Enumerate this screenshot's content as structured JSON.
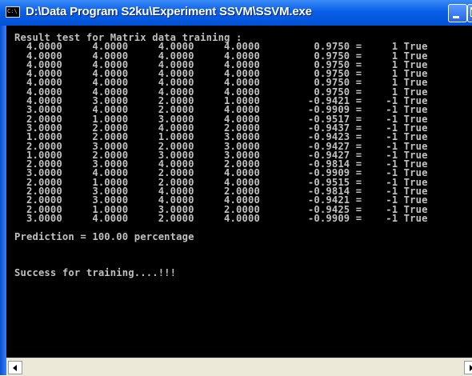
{
  "window": {
    "title": "D:\\Data Program S2ku\\Experiment SSVM\\SSVM.exe",
    "icon_text": "C:\\"
  },
  "console": {
    "header": "Result test for Matrix data training :",
    "rows": [
      [
        "4.0000",
        "4.0000",
        "4.0000",
        "4.0000",
        "0.9750",
        "1",
        "True"
      ],
      [
        "4.0000",
        "4.0000",
        "4.0000",
        "4.0000",
        "0.9750",
        "1",
        "True"
      ],
      [
        "4.0000",
        "4.0000",
        "4.0000",
        "4.0000",
        "0.9750",
        "1",
        "True"
      ],
      [
        "4.0000",
        "4.0000",
        "4.0000",
        "4.0000",
        "0.9750",
        "1",
        "True"
      ],
      [
        "4.0000",
        "4.0000",
        "4.0000",
        "4.0000",
        "0.9750",
        "1",
        "True"
      ],
      [
        "4.0000",
        "4.0000",
        "4.0000",
        "4.0000",
        "0.9750",
        "1",
        "True"
      ],
      [
        "4.0000",
        "3.0000",
        "2.0000",
        "1.0000",
        "-0.9421",
        "-1",
        "True"
      ],
      [
        "3.0000",
        "4.0000",
        "2.0000",
        "4.0000",
        "-0.9909",
        "-1",
        "True"
      ],
      [
        "2.0000",
        "1.0000",
        "3.0000",
        "4.0000",
        "-0.9517",
        "-1",
        "True"
      ],
      [
        "3.0000",
        "2.0000",
        "4.0000",
        "2.0000",
        "-0.9437",
        "-1",
        "True"
      ],
      [
        "1.0000",
        "2.0000",
        "1.0000",
        "3.0000",
        "-0.9423",
        "-1",
        "True"
      ],
      [
        "2.0000",
        "3.0000",
        "2.0000",
        "3.0000",
        "-0.9427",
        "-1",
        "True"
      ],
      [
        "1.0000",
        "2.0000",
        "3.0000",
        "3.0000",
        "-0.9427",
        "-1",
        "True"
      ],
      [
        "2.0000",
        "3.0000",
        "4.0000",
        "2.0000",
        "-0.9814",
        "-1",
        "True"
      ],
      [
        "3.0000",
        "4.0000",
        "2.0000",
        "4.0000",
        "-0.9909",
        "-1",
        "True"
      ],
      [
        "2.0000",
        "1.0000",
        "2.0000",
        "4.0000",
        "-0.9515",
        "-1",
        "True"
      ],
      [
        "2.0000",
        "3.0000",
        "4.0000",
        "2.0000",
        "-0.9814",
        "-1",
        "True"
      ],
      [
        "2.0000",
        "3.0000",
        "4.0000",
        "4.0000",
        "-0.9421",
        "-1",
        "True"
      ],
      [
        "2.0000",
        "1.0000",
        "3.0000",
        "2.0000",
        "-0.9425",
        "-1",
        "True"
      ],
      [
        "3.0000",
        "4.0000",
        "2.0000",
        "4.0000",
        "-0.9909",
        "-1",
        "True"
      ]
    ],
    "prediction": "Prediction = 100.00 percentage",
    "success": "Success for training....!!!"
  },
  "colors": {
    "titlebar": "#0a5fe8",
    "console_bg": "#000000",
    "console_text": "#c0c0c0"
  },
  "icons": [
    "console-app-icon",
    "minimize-icon",
    "maximize-icon",
    "scroll-left-icon",
    "scroll-right-icon"
  ]
}
